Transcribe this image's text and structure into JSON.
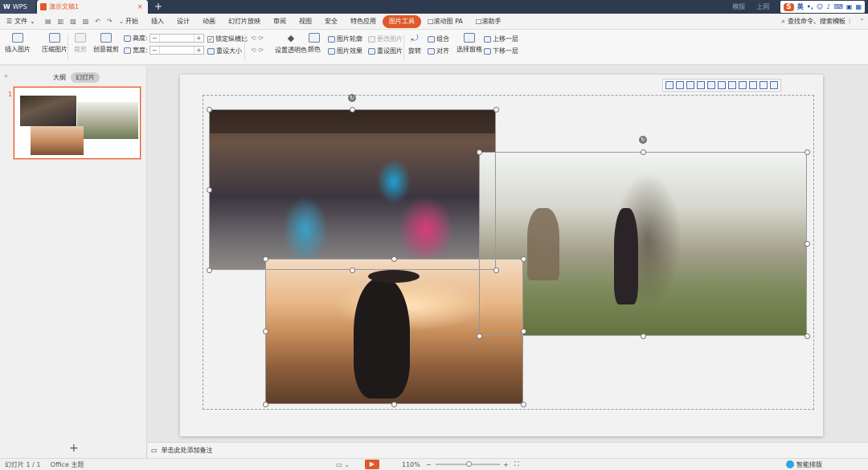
{
  "titlebar": {
    "app_name": "WPS",
    "doc_tab": "演示文稿1",
    "close_glyph": "×",
    "new_tab": "+",
    "right": {
      "item1": "模版",
      "item2": "上网"
    },
    "ime": {
      "logo": "S",
      "lang": "英"
    }
  },
  "menubar": {
    "file": "文件",
    "tabs": [
      "开始",
      "插入",
      "设计",
      "动画",
      "幻灯片放映",
      "审阅",
      "视图",
      "安全",
      "特色应用",
      "图片工具",
      "□滚动图 PA",
      "□滚助手"
    ],
    "active_tab": "图片工具",
    "search": "查找命令、搜索模板"
  },
  "ribbon": {
    "insert_picture": "插入图片",
    "compress": "压缩图片",
    "crop": "裁剪",
    "create_board": "创意裁剪",
    "height_label": "高度:",
    "width_label": "宽度:",
    "lock_ratio": "锁定纵横比",
    "reset_size": "重设大小",
    "transparent": "设置透明色",
    "color": "颜色",
    "outline": "图片轮廓",
    "effect": "图片效果",
    "change_pic": "更改图片",
    "reset_pic": "重设图片",
    "rotate": "旋转",
    "group": "组合",
    "align": "对齐",
    "select_pane": "选择窗格",
    "up_layer": "上移一层",
    "down_layer": "下移一层"
  },
  "leftpanel": {
    "outline_tab": "大纲",
    "slides_tab": "幻灯片",
    "slide_number": "1",
    "add": "+"
  },
  "notes": {
    "placeholder": "单击此处添加备注"
  },
  "statusbar": {
    "slide_count": "幻灯片 1 / 1",
    "theme": "Office 主题",
    "zoom": "110%",
    "smart_layout": "智能排版"
  }
}
